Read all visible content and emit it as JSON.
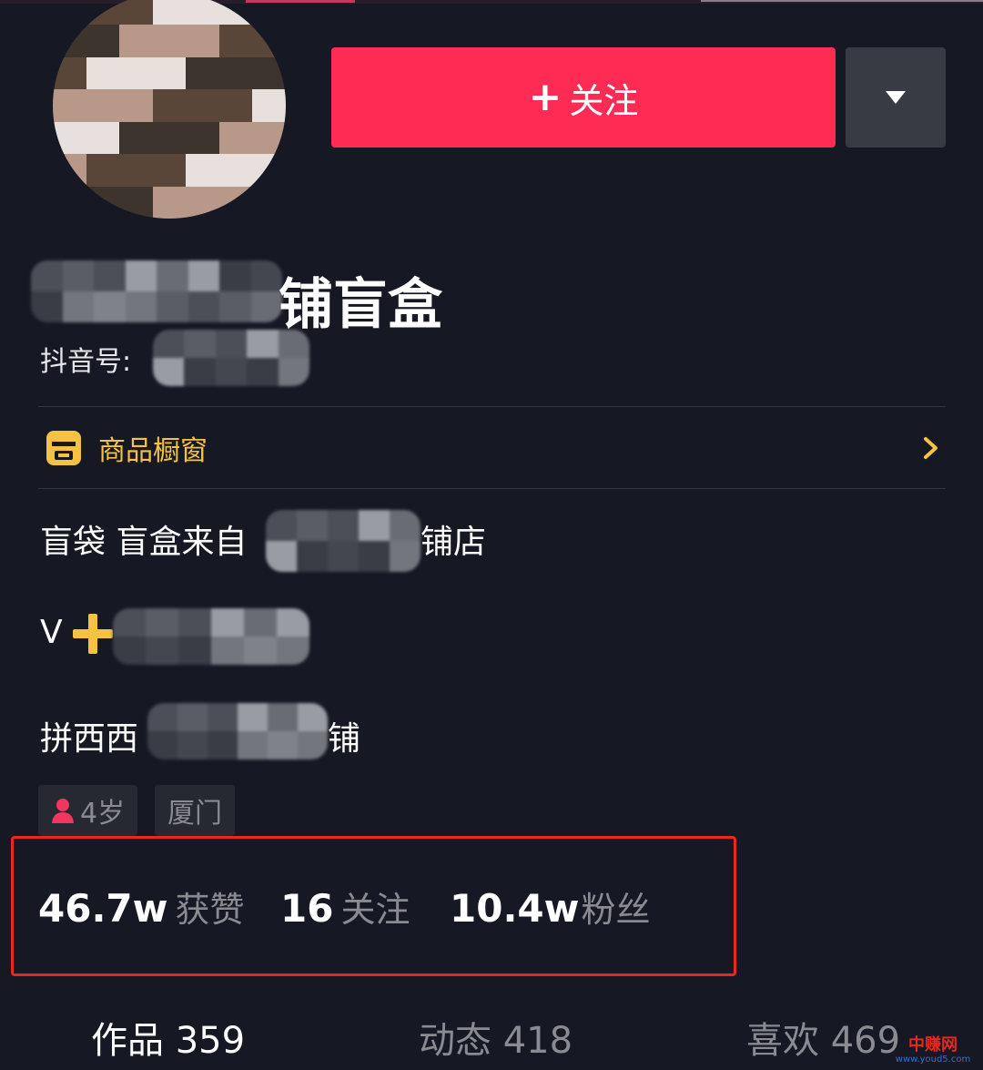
{
  "header": {
    "follow_label": "关注",
    "dropdown_icon": "triangle-down-icon"
  },
  "profile": {
    "name_visible": "铺盲盒",
    "id_label": "抖音号:"
  },
  "showcase": {
    "label": "商品橱窗",
    "icon": "shop-icon",
    "icon_color": "#f5c242"
  },
  "bio": {
    "line1_prefix": "盲袋 盲盒来自",
    "line1_suffix": "铺店",
    "line2_prefix": "V",
    "line3_prefix": "拼西西",
    "line3_suffix": "铺"
  },
  "tags": {
    "age": "4岁",
    "city": "厦门"
  },
  "stats": {
    "likes_value": "46.7w",
    "likes_label": "获赞",
    "following_value": "16",
    "following_label": "关注",
    "followers_value": "10.4w",
    "followers_label": "粉丝"
  },
  "tabs": [
    {
      "label": "作品 359"
    },
    {
      "label": "动态 418"
    },
    {
      "label": "喜欢 469"
    }
  ],
  "watermark": {
    "line1": "中赚网",
    "line2": "www.youd5.com"
  },
  "colors": {
    "background": "#161823",
    "accent": "#fe2c55",
    "highlight_frame": "#e8281f",
    "yellow": "#f5c242"
  }
}
